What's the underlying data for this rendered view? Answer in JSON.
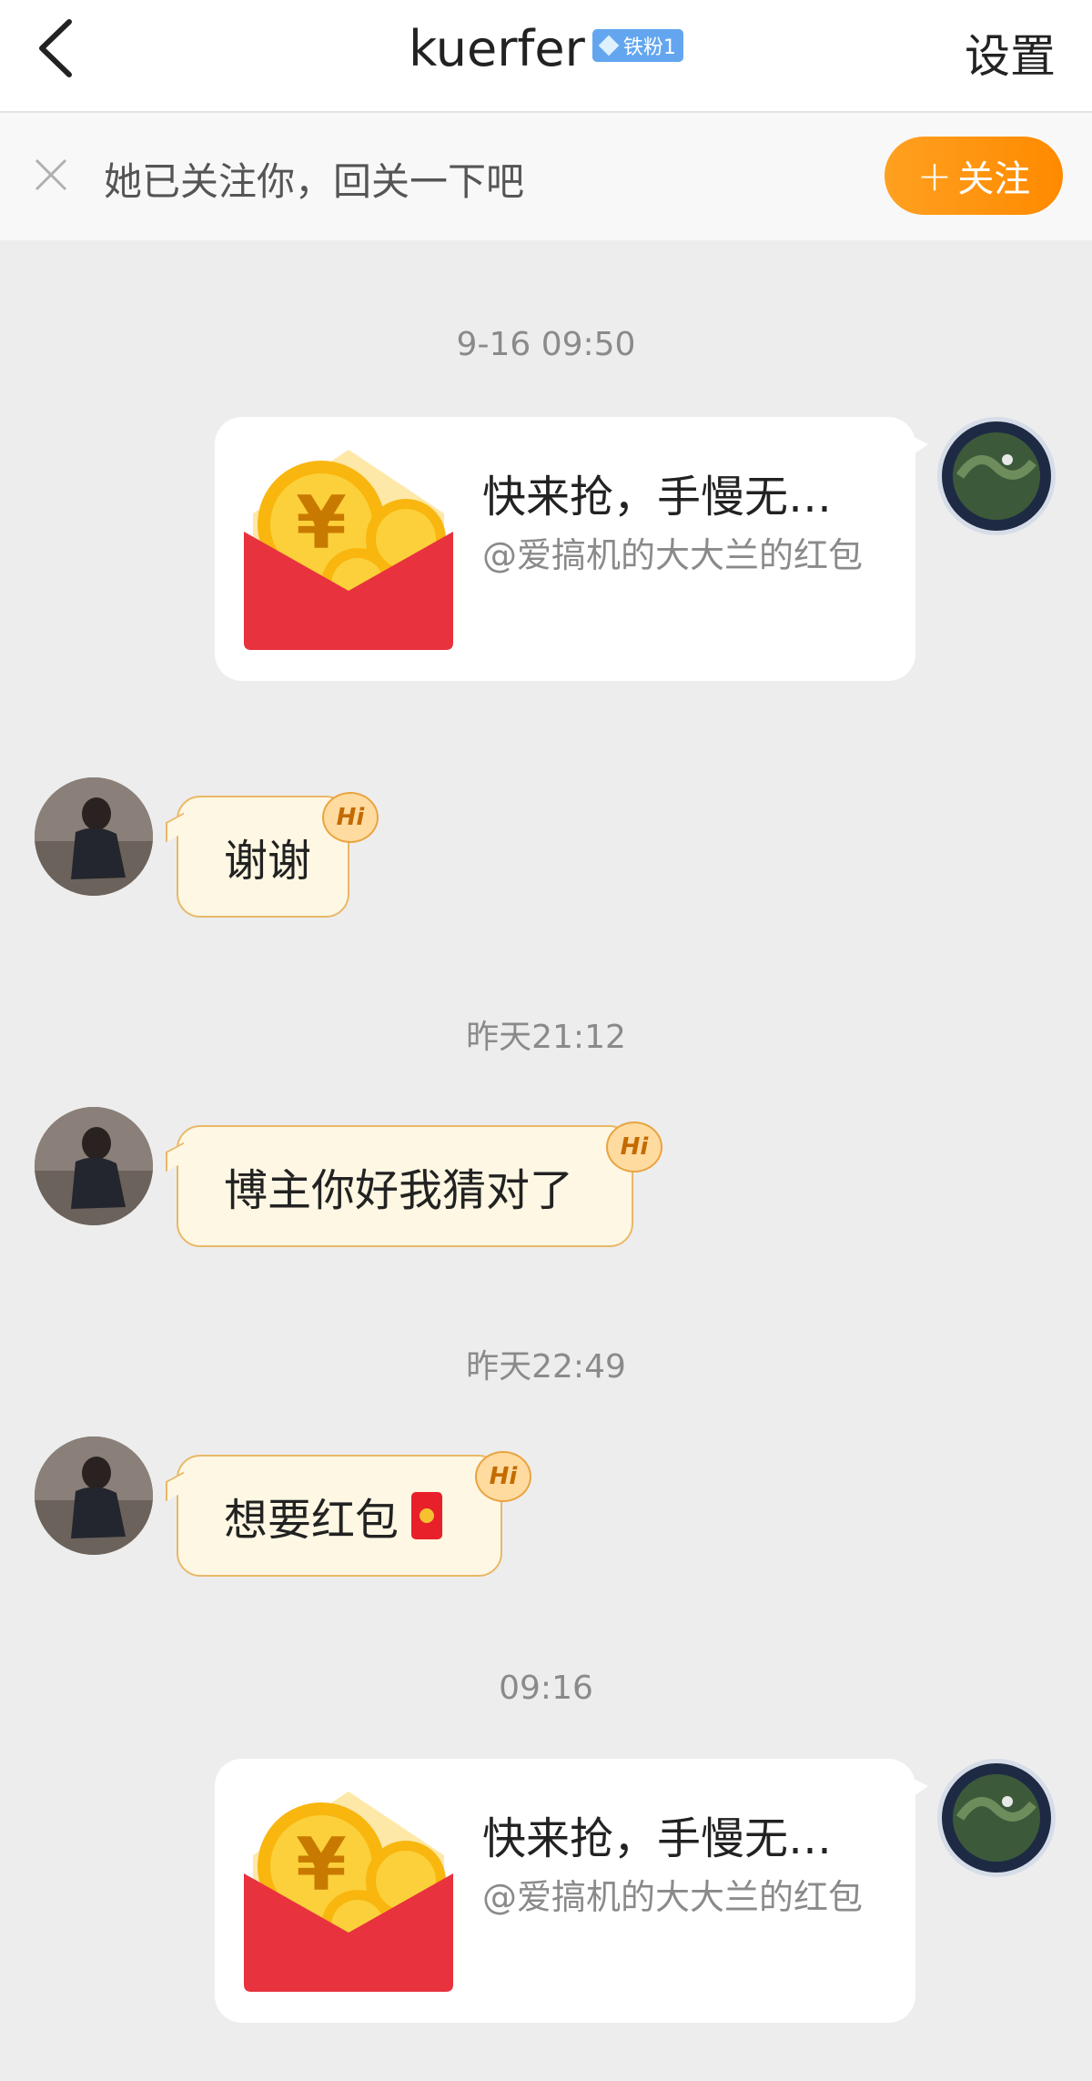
{
  "header": {
    "title": "kuerfer",
    "badge_label": "铁粉1",
    "settings_label": "设置"
  },
  "follow_prompt": {
    "text": "她已关注你，回关一下吧",
    "button_label": "关注",
    "button_plus": "+"
  },
  "messages": {
    "m1": {
      "time": "9-16 09:50",
      "title": "快来抢，手慢无…",
      "subtitle": "@爱搞机的大大兰的红包"
    },
    "m2": {
      "text": "谢谢",
      "hi": "Hi"
    },
    "m3": {
      "time": "昨天21:12",
      "text": "博主你好我猜对了",
      "hi": "Hi"
    },
    "m4": {
      "time": "昨天22:49",
      "text": "想要红包",
      "hi": "Hi"
    },
    "m5": {
      "time": "09:16",
      "title": "快来抢，手慢无…",
      "subtitle": "@爱搞机的大大兰的红包"
    }
  },
  "icons": {
    "back": "chevron-left-icon",
    "close": "close-icon",
    "red_envelope": "red-envelope-icon",
    "badge": "diamond-icon"
  },
  "colors": {
    "follow_button": "#ff9a10",
    "incoming_bubble_bg": "#fdf7e3",
    "incoming_bubble_border": "#e9b868",
    "badge_bg": "#63a6ef",
    "envelope_red": "#e8323e",
    "coin_gold": "#f8b60e"
  }
}
